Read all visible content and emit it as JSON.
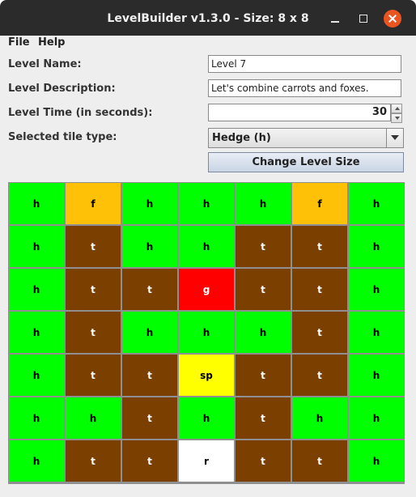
{
  "window": {
    "title": "LevelBuilder v1.3.0 - Size: 8 x 8"
  },
  "menu": {
    "file": "File",
    "help": "Help"
  },
  "form": {
    "name_label": "Level Name:",
    "name_value": "Level 7",
    "description_label": "Level Description:",
    "description_value": "Let's combine carrots and foxes.",
    "time_label": "Level Time (in seconds):",
    "time_value": "30",
    "tile_type_label": "Selected tile type:",
    "tile_type_value": "Hedge (h)",
    "change_size_button": "Change Level Size"
  },
  "colors": {
    "h": "#00ff00",
    "f": "#ffc107",
    "t": "#7b3f00",
    "g": "#ff0000",
    "sp": "#ffff00",
    "r": "#ffffff",
    "text_light": "#ffffff",
    "text_dark": "#000000"
  },
  "grid": {
    "rows": [
      [
        "h",
        "f",
        "h",
        "h",
        "h",
        "f",
        "h"
      ],
      [
        "h",
        "t",
        "h",
        "h",
        "t",
        "t",
        "h"
      ],
      [
        "h",
        "t",
        "t",
        "g",
        "t",
        "t",
        "h"
      ],
      [
        "h",
        "t",
        "h",
        "h",
        "h",
        "t",
        "h"
      ],
      [
        "h",
        "t",
        "t",
        "sp",
        "t",
        "t",
        "h"
      ],
      [
        "h",
        "h",
        "t",
        "h",
        "t",
        "h",
        "h"
      ],
      [
        "h",
        "t",
        "t",
        "r",
        "t",
        "t",
        "h"
      ]
    ]
  }
}
